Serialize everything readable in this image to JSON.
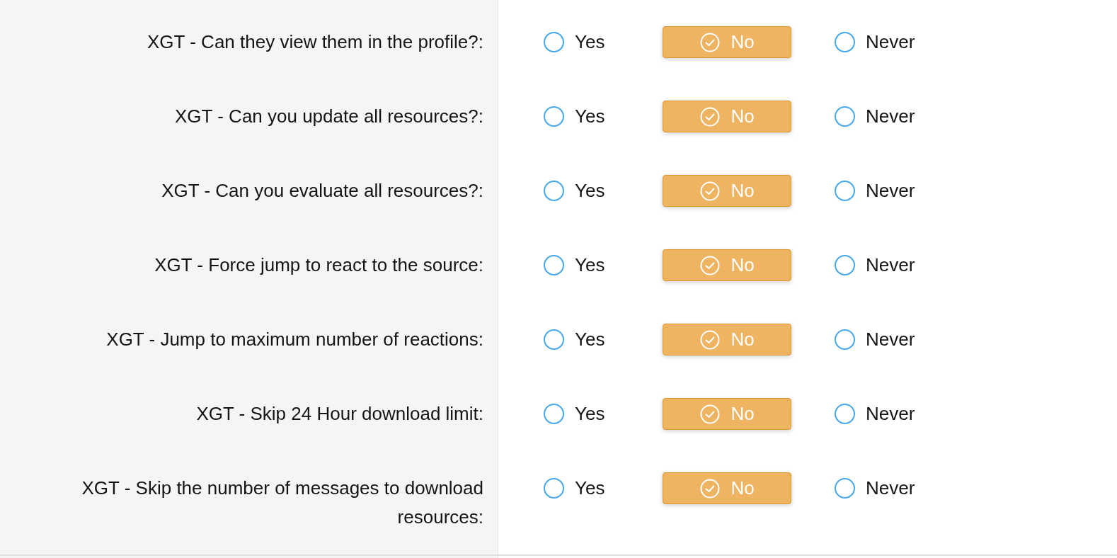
{
  "rows": [
    {
      "label": "XGT - Can they view them in the profile?:",
      "options": [
        {
          "label": "Yes",
          "selected": false
        },
        {
          "label": "No",
          "selected": true
        },
        {
          "label": "Never",
          "selected": false
        }
      ]
    },
    {
      "label": "XGT - Can you update all resources?:",
      "options": [
        {
          "label": "Yes",
          "selected": false
        },
        {
          "label": "No",
          "selected": true
        },
        {
          "label": "Never",
          "selected": false
        }
      ]
    },
    {
      "label": "XGT - Can you evaluate all resources?:",
      "options": [
        {
          "label": "Yes",
          "selected": false
        },
        {
          "label": "No",
          "selected": true
        },
        {
          "label": "Never",
          "selected": false
        }
      ]
    },
    {
      "label": "XGT - Force jump to react to the source:",
      "options": [
        {
          "label": "Yes",
          "selected": false
        },
        {
          "label": "No",
          "selected": true
        },
        {
          "label": "Never",
          "selected": false
        }
      ]
    },
    {
      "label": "XGT - Jump to maximum number of reactions:",
      "options": [
        {
          "label": "Yes",
          "selected": false
        },
        {
          "label": "No",
          "selected": true
        },
        {
          "label": "Never",
          "selected": false
        }
      ]
    },
    {
      "label": "XGT - Skip 24 Hour download limit:",
      "options": [
        {
          "label": "Yes",
          "selected": false
        },
        {
          "label": "No",
          "selected": true
        },
        {
          "label": "Never",
          "selected": false
        }
      ]
    },
    {
      "label": "XGT - Skip the number of messages to download resources:",
      "options": [
        {
          "label": "Yes",
          "selected": false
        },
        {
          "label": "No",
          "selected": true
        },
        {
          "label": "Never",
          "selected": false
        }
      ]
    }
  ]
}
